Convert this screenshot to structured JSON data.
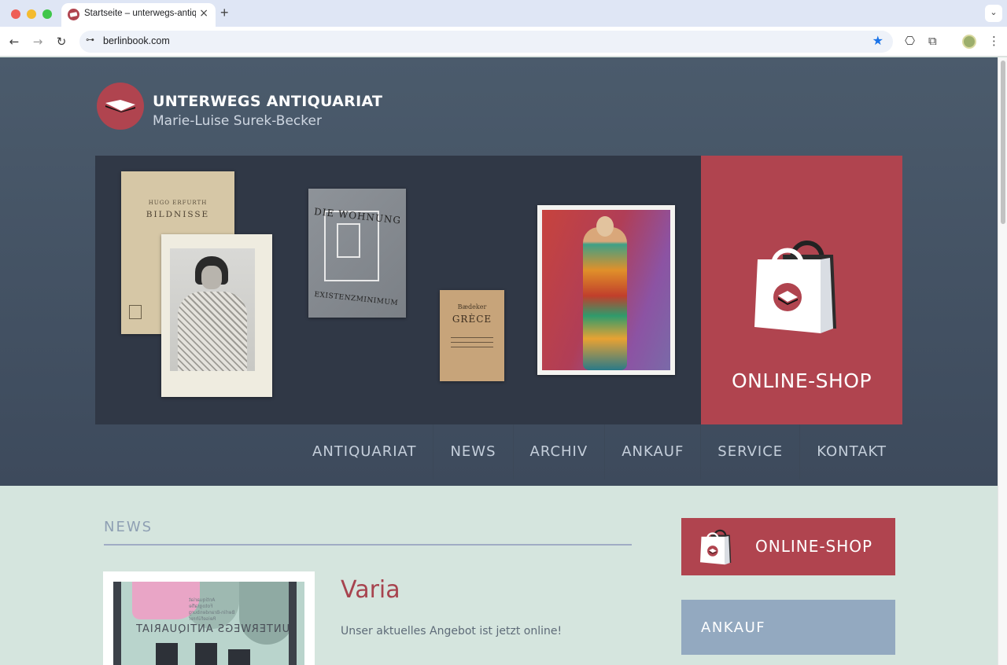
{
  "browser": {
    "tab_title": "Startseite – unterwegs-antiquariat",
    "tab_close": "×",
    "new_tab": "+",
    "tab_menu": "⌄",
    "url": "berlinbook.com",
    "icons": {
      "back": "←",
      "forward": "→",
      "reload": "↻",
      "site_info": "⊶",
      "star": "★",
      "bookmark": "⎔",
      "extensions": "⧉",
      "menu": "⋮"
    }
  },
  "brand": {
    "name": "UNTERWEGS ANTIQUARIAT",
    "subtitle": "Marie-Luise Surek-Becker",
    "accent_color": "#b0444f"
  },
  "hero": {
    "book1_author": "HUGO ERFURTH",
    "book1_title": "BILDNISSE",
    "book2_title": "DIE WOHNUNG",
    "book2_subtitle": "EXISTENZMINIMUM",
    "book3_publisher": "Bædeker",
    "book3_title": "GRÈCE",
    "shop_label": "ONLINE-SHOP"
  },
  "nav": {
    "items": [
      "ANTIQUARIAT",
      "NEWS",
      "ARCHIV",
      "ANKAUF",
      "SERVICE",
      "KONTAKT"
    ]
  },
  "news": {
    "heading": "NEWS",
    "poster_text": "UNTERWEGS ANTIQUARIAT",
    "title": "Varia",
    "text": "Unser aktuelles Angebot ist jetzt online!"
  },
  "sidebar": {
    "shop_label": "ONLINE-SHOP",
    "ankauf_label": "ANKAUF"
  }
}
